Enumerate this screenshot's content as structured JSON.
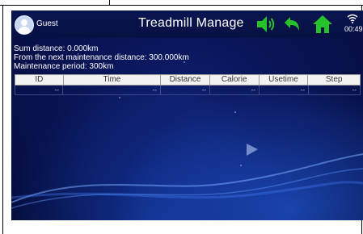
{
  "header": {
    "user_name": "Guest",
    "title": "Treadmill Manage",
    "clock": "00:49",
    "icons": [
      "volume-icon",
      "back-icon",
      "home-icon",
      "wifi-icon"
    ],
    "accent_color": "#27c12a"
  },
  "info": {
    "sum_distance": "Sum distance: 0.000km",
    "next_maintenance": "From the next maintenance distance: 300.000km",
    "maintenance_period": "Maintenance period: 300km"
  },
  "table": {
    "columns": [
      "ID",
      "Time",
      "Distance",
      "Calorie",
      "Usetime",
      "Step"
    ],
    "rows": [
      [
        "--",
        "--",
        "--",
        "--",
        "--",
        "--"
      ]
    ]
  }
}
